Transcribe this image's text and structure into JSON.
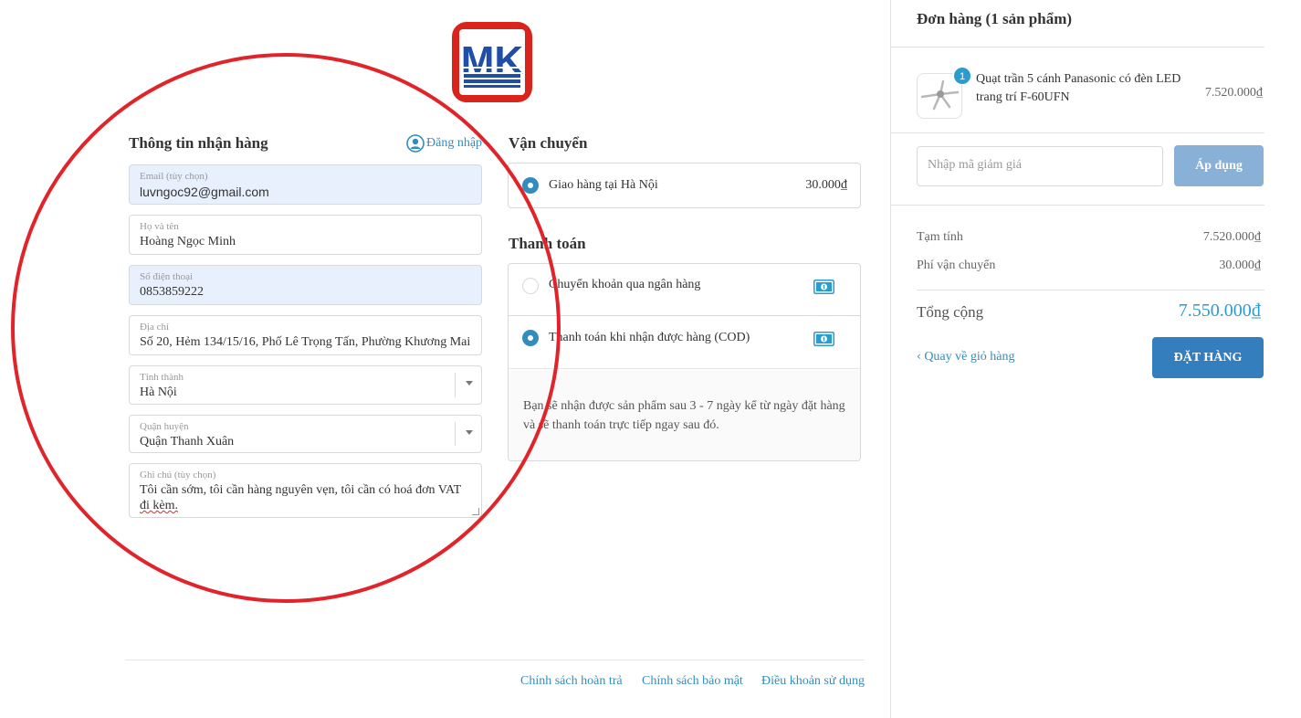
{
  "brand": {
    "logo_text": "MK"
  },
  "customer": {
    "title": "Thông tin nhận hàng",
    "login_label": "Đăng nhập",
    "email": {
      "label": "Email (tùy chọn)",
      "value": "luvngoc92@gmail.com"
    },
    "name": {
      "label": "Họ và tên",
      "value": "Hoàng Ngọc Minh"
    },
    "phone": {
      "label": "Số điện thoại",
      "value": "0853859222"
    },
    "address": {
      "label": "Địa chỉ",
      "value": "Số 20, Hẻm 134/15/16, Phố Lê Trọng Tấn, Phường Khương Mai"
    },
    "province": {
      "label": "Tỉnh thành",
      "value": "Hà Nội"
    },
    "district": {
      "label": "Quận huyện",
      "value": "Quận Thanh Xuân"
    },
    "note": {
      "label": "Ghi chú (tùy chọn)",
      "value_line1": "Tôi cần sớm, tôi cần hàng nguyên vẹn, tôi cần có hoá đơn VAT",
      "value_line2": "đi kèm."
    }
  },
  "shipping": {
    "title": "Vận chuyển",
    "option": {
      "label": "Giao hàng tại Hà Nội",
      "price": "30.000₫"
    }
  },
  "payment": {
    "title": "Thanh toán",
    "options": [
      {
        "label": "Chuyển khoản qua ngân hàng",
        "selected": false
      },
      {
        "label": "Thanh toán khi nhận được hàng (COD)",
        "selected": true
      }
    ],
    "cod_note_line1": "Bạn sẽ nhận được sản phẩm sau 3 - 7 ngày kể từ ngày đặt hàng",
    "cod_note_line2": "và sẽ thanh toán trực tiếp ngay sau đó."
  },
  "footer": {
    "links": [
      "Chính sách hoàn trả",
      "Chính sách bảo mật",
      "Điều khoản sử dụng"
    ]
  },
  "order": {
    "title": "Đơn hàng (1 sản phẩm)",
    "item": {
      "qty": "1",
      "name": "Quạt trần 5 cánh Panasonic có đèn LED trang trí F-60UFN",
      "price": "7.520.000₫"
    },
    "coupon_placeholder": "Nhập mã giảm giá",
    "apply_label": "Áp dụng",
    "subtotal_label": "Tạm tính",
    "subtotal_value": "7.520.000₫",
    "shipping_label": "Phí vận chuyển",
    "shipping_value": "30.000₫",
    "total_label": "Tổng cộng",
    "total_value": "7.550.000₫",
    "back_label": "Quay về giỏ hàng",
    "place_order_label": "ĐẶT HÀNG"
  },
  "colors": {
    "accent": "#338dbc",
    "annotation": "#e0242a",
    "button": "#357ebd"
  }
}
